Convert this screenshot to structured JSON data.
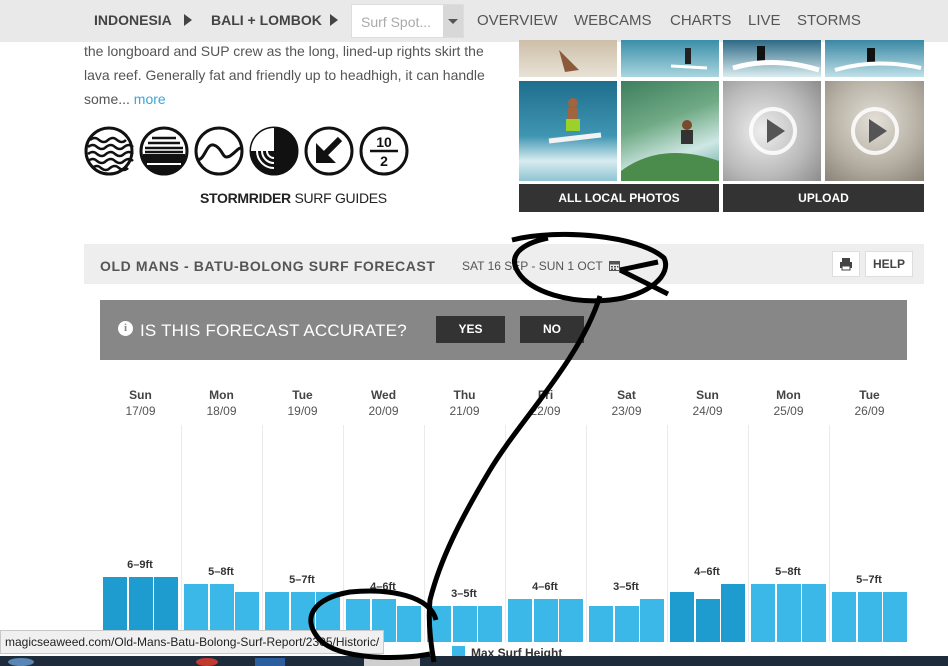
{
  "nav": {
    "breadcrumb": [
      "INDONESIA",
      "BALI + LOMBOK"
    ],
    "spot_placeholder": "Surf Spot...",
    "links": [
      "OVERVIEW",
      "WEBCAMS",
      "CHARTS",
      "LIVE",
      "STORMS"
    ]
  },
  "description": {
    "text": "the longboard and SUP crew as the long, lined-up rights skirt the lava reef. Generally fat and friendly up to headhigh, it can handle some...",
    "more_label": "more"
  },
  "rating": {
    "icons": [
      "wave-lines-icon",
      "beach-lines-icon",
      "swell-curve-icon",
      "shelf-icon",
      "direction-arrow-icon",
      "rating-fraction-icon"
    ],
    "fraction_top": "10",
    "fraction_bottom": "2",
    "guide_brand": "STORMRIDER",
    "guide_suffix": " SURF GUIDES"
  },
  "photos": {
    "all_photos_label": "ALL LOCAL PHOTOS",
    "upload_label": "UPLOAD"
  },
  "forecast": {
    "title": "OLD MANS - BATU-BOLONG SURF FORECAST",
    "date_range": "SAT 16 SEP - SUN 1 OCT",
    "help_label": "HELP",
    "accuracy_question": "IS THIS FORECAST ACCURATE?",
    "yes_label": "YES",
    "no_label": "NO",
    "legend_label": "Max Surf Height"
  },
  "days": [
    {
      "day": "Sun",
      "date": "17/09"
    },
    {
      "day": "Mon",
      "date": "18/09"
    },
    {
      "day": "Tue",
      "date": "19/09"
    },
    {
      "day": "Wed",
      "date": "20/09"
    },
    {
      "day": "Thu",
      "date": "21/09"
    },
    {
      "day": "Fri",
      "date": "22/09"
    },
    {
      "day": "Sat",
      "date": "23/09"
    },
    {
      "day": "Sun",
      "date": "24/09"
    },
    {
      "day": "Mon",
      "date": "25/09"
    },
    {
      "day": "Tue",
      "date": "26/09"
    }
  ],
  "chart_data": {
    "type": "bar",
    "categories": [
      "17/09",
      "18/09",
      "19/09",
      "20/09",
      "21/09",
      "22/09",
      "23/09",
      "24/09",
      "25/09",
      "26/09"
    ],
    "series": [
      {
        "name": "Max Surf Height",
        "values": [
          [
            9,
            9,
            9
          ],
          [
            8,
            8,
            7
          ],
          [
            7,
            7,
            7
          ],
          [
            6,
            6,
            5
          ],
          [
            5,
            5,
            5
          ],
          [
            6,
            6,
            6
          ],
          [
            5,
            5,
            6
          ],
          [
            7,
            6,
            8
          ],
          [
            8,
            8,
            8
          ],
          [
            7,
            7,
            7
          ]
        ]
      }
    ],
    "labels": [
      "6–9ft",
      "5–8ft",
      "5–7ft",
      "4–6ft",
      "3–5ft",
      "4–6ft",
      "3–5ft",
      "4–6ft",
      "5–8ft",
      "5–7ft"
    ],
    "colors": {
      "bar": "#3bb8e8",
      "bar_dark": "#1e9bcf"
    }
  },
  "status": {
    "url": "magicseaweed.com/Old-Mans-Batu-Bolong-Surf-Report/2305/Historic/"
  }
}
